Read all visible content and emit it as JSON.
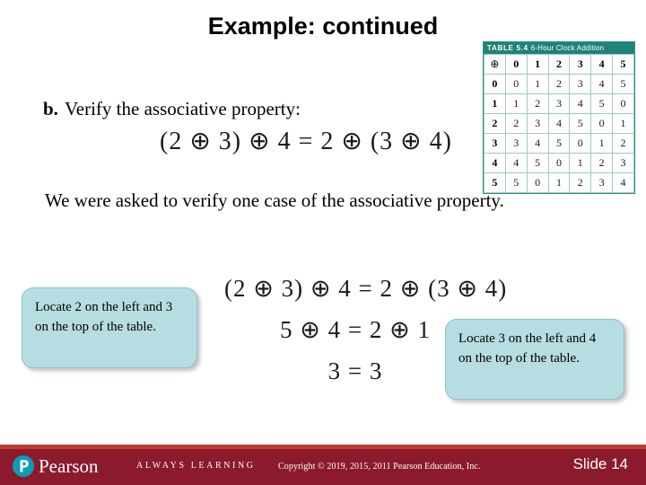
{
  "slide": {
    "title": "Example: continued",
    "item_b": {
      "label": "b.",
      "text": "Verify the associative property:",
      "equation": "(2 ⊕ 3) ⊕ 4 = 2 ⊕ (3 ⊕ 4)"
    },
    "paragraph": "We were asked to verify one case of the associative property.",
    "work": {
      "line1": "(2 ⊕ 3) ⊕ 4 = 2 ⊕ (3 ⊕ 4)",
      "line2": "5 ⊕ 4 = 2 ⊕ 1",
      "line3": "3 = 3"
    },
    "callouts": [
      {
        "text": "Locate 2 on the left and 3 on the top of the table."
      },
      {
        "text": "Locate 3 on the left and 4 on the top of the table."
      }
    ]
  },
  "table": {
    "caption_label": "TABLE 5.4",
    "caption_text": "6-Hour Clock Addition",
    "operator": "⊕",
    "columns": [
      "0",
      "1",
      "2",
      "3",
      "4",
      "5"
    ],
    "rows": [
      {
        "head": "0",
        "cells": [
          "0",
          "1",
          "2",
          "3",
          "4",
          "5"
        ]
      },
      {
        "head": "1",
        "cells": [
          "1",
          "2",
          "3",
          "4",
          "5",
          "0"
        ]
      },
      {
        "head": "2",
        "cells": [
          "2",
          "3",
          "4",
          "5",
          "0",
          "1"
        ]
      },
      {
        "head": "3",
        "cells": [
          "3",
          "4",
          "5",
          "0",
          "1",
          "2"
        ]
      },
      {
        "head": "4",
        "cells": [
          "4",
          "5",
          "0",
          "1",
          "2",
          "3"
        ]
      },
      {
        "head": "5",
        "cells": [
          "5",
          "0",
          "1",
          "2",
          "3",
          "4"
        ]
      }
    ],
    "header_color": "#1f8377",
    "border_color": "#9ec9c6"
  },
  "footer": {
    "brand": "Pearson",
    "tagline": "ALWAYS LEARNING",
    "copyright": "Copyright © 2019, 2015, 2011 Pearson Education, Inc.",
    "slide_label": "Slide 14",
    "bar_color": "#8a1a2c",
    "stripe_color": "#c0392f",
    "logo_color": "#0f9bb5"
  }
}
